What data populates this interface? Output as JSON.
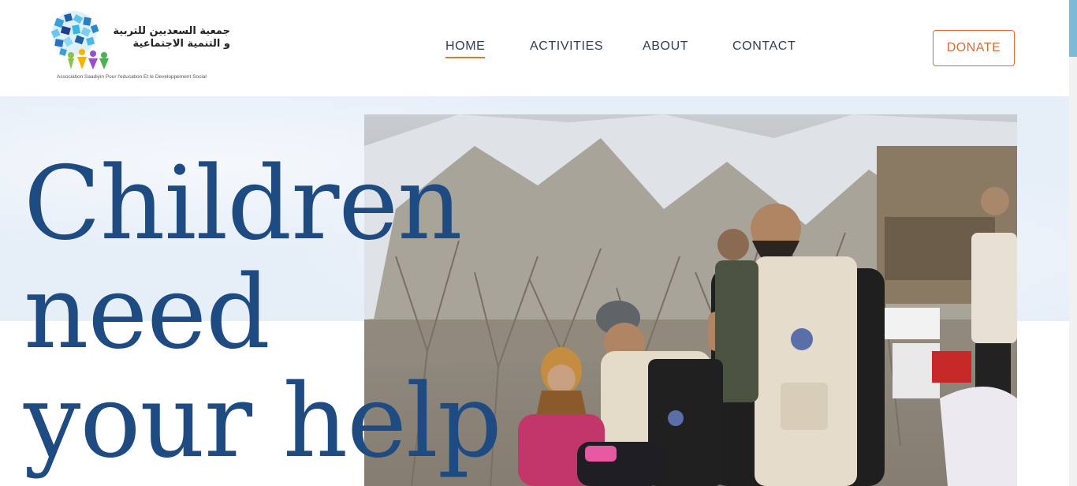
{
  "logo": {
    "arabic_line_1": "جمعية السعديين للتربية",
    "arabic_line_2": "و التنمية الاجتماعية",
    "latin_name": "Association Saadiyin Pour l'education Et le Developpement Social"
  },
  "nav": {
    "items": [
      {
        "label": "HOME",
        "active": true
      },
      {
        "label": "ACTIVITIES",
        "active": false
      },
      {
        "label": "ABOUT",
        "active": false
      },
      {
        "label": "CONTACT",
        "active": false
      }
    ]
  },
  "donate_label": "DONATE",
  "hero": {
    "headline_lines": [
      "Children",
      "need",
      "your help"
    ],
    "photo_icon": "volunteers-with-children-photo"
  },
  "colors": {
    "accent": "#e06a2b",
    "headline": "#1d4b82",
    "nav_text": "#2f3e55",
    "hero_bg": "#e6eef8",
    "scroll_thumb": "#7fb9d8"
  }
}
